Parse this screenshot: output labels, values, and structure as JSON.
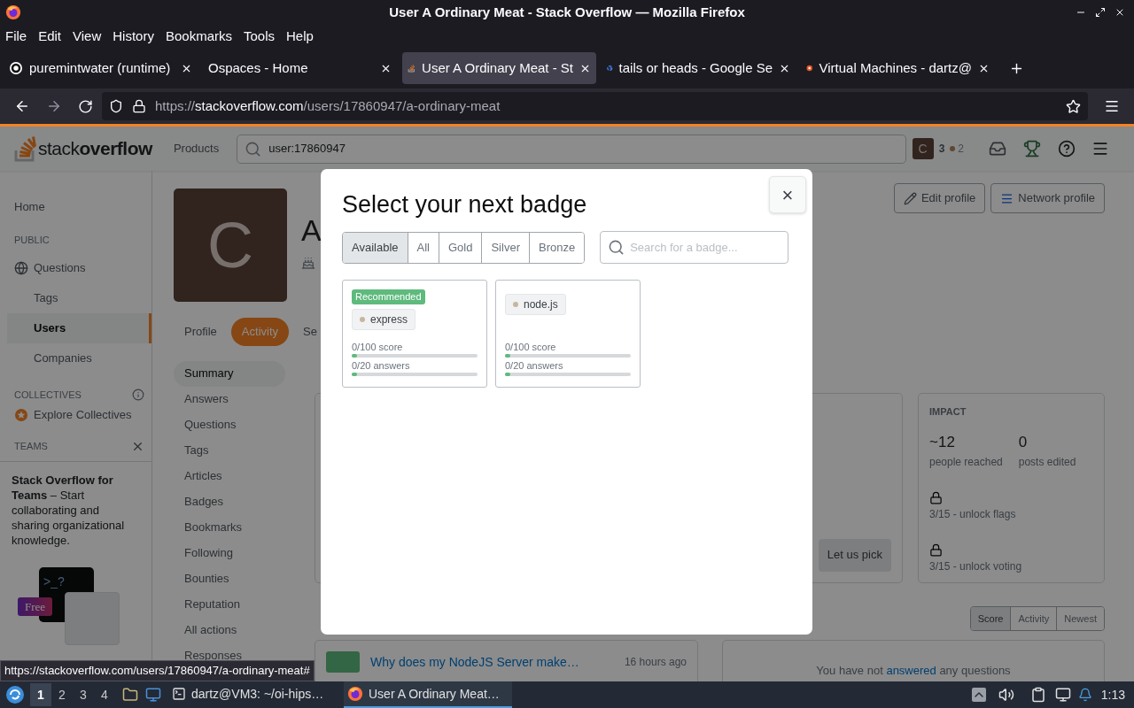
{
  "window": {
    "title": "User A Ordinary Meat - Stack Overflow — Mozilla Firefox"
  },
  "menu": [
    "File",
    "Edit",
    "View",
    "History",
    "Bookmarks",
    "Tools",
    "Help"
  ],
  "tabs": [
    {
      "label": "puremintwater (runtime)",
      "kind": "ring",
      "selected": false
    },
    {
      "label": "Ospaces - Home",
      "kind": "none",
      "selected": false
    },
    {
      "label": "User A Ordinary Meat - St",
      "kind": "stack",
      "selected": true
    },
    {
      "label": "tails or heads - Google Se",
      "kind": "google",
      "selected": false
    },
    {
      "label": "Virtual Machines - dartz@",
      "kind": "dot",
      "selected": false
    }
  ],
  "address": {
    "scheme": "https://",
    "domain": "stackoverflow.com",
    "path": "/users/17860947/a-ordinary-meat"
  },
  "header": {
    "logo": "stack**overflow**",
    "products": "Products",
    "search": "user:17860947",
    "avatar": "C",
    "reputation": "3",
    "bronze": "2"
  },
  "nav": {
    "home": "Home",
    "public": {
      "heading": "PUBLIC",
      "items": [
        {
          "label": "Questions",
          "kind": "main",
          "selected": false
        },
        {
          "label": "Tags",
          "kind": "sub",
          "selected": false
        },
        {
          "label": "Users",
          "kind": "sub",
          "selected": true
        },
        {
          "label": "Companies",
          "kind": "sub",
          "selected": false
        }
      ]
    },
    "collectives": {
      "heading": "COLLECTIVES",
      "item": "Explore Collectives"
    },
    "teams": {
      "heading": "TEAMS",
      "text": "**Stack Overflow for Teams** – Start collaborating and sharing organizational knowledge.",
      "prompt": ">_?",
      "badge": "Free"
    }
  },
  "profile": {
    "avatar": "C",
    "name": "A",
    "edit": "Edit profile",
    "network": "Network profile",
    "tabs": [
      {
        "label": "Profile",
        "selected": false
      },
      {
        "label": "Activity",
        "selected": true
      },
      {
        "label": "Se",
        "selected": false
      }
    ]
  },
  "activity_nav": [
    {
      "label": "Summary",
      "selected": true
    },
    {
      "label": "Answers",
      "selected": false
    },
    {
      "label": "Questions",
      "selected": false
    },
    {
      "label": "Tags",
      "selected": false
    },
    {
      "label": "Articles",
      "selected": false
    },
    {
      "label": "Badges",
      "selected": false
    },
    {
      "label": "Bookmarks",
      "selected": false
    },
    {
      "label": "Following",
      "selected": false
    },
    {
      "label": "Bounties",
      "selected": false
    },
    {
      "label": "Reputation",
      "selected": false
    },
    {
      "label": "All actions",
      "selected": false
    },
    {
      "label": "Responses",
      "selected": false
    }
  ],
  "summary": {
    "pick": "Let us pick",
    "impact": {
      "heading": "IMPACT",
      "stats": [
        {
          "value": "~12",
          "label": "people reached"
        },
        {
          "value": "0",
          "label": "posts edited"
        }
      ],
      "unlocks": [
        "3/15 - unlock flags",
        "3/15 - unlock voting"
      ]
    }
  },
  "questions": {
    "sort": [
      {
        "label": "Score",
        "selected": true
      },
      {
        "label": "Activity",
        "selected": false
      },
      {
        "label": "Newest",
        "selected": false
      }
    ],
    "items": [
      {
        "title": "Why does my NodeJS Server make…",
        "time": "16 hours ago"
      }
    ]
  },
  "answers": {
    "before": "You have not ",
    "link": "answered",
    "after": " any questions"
  },
  "modal": {
    "title": "Select your next badge",
    "close": "×",
    "filters": [
      {
        "label": "Available",
        "selected": true
      },
      {
        "label": "All",
        "selected": false
      },
      {
        "label": "Gold",
        "selected": false
      },
      {
        "label": "Silver",
        "selected": false
      },
      {
        "label": "Bronze",
        "selected": false
      }
    ],
    "search_placeholder": "Search for a badge...",
    "badges": [
      {
        "recommended": "Recommended",
        "tag": "express",
        "progress": [
          {
            "label": "0/100 score",
            "level": 0.04
          },
          {
            "label": "0/20 answers",
            "level": 0.04
          }
        ]
      },
      {
        "tag": "node.js",
        "progress": [
          {
            "label": "0/100 score",
            "level": 0.04
          },
          {
            "label": "0/20 answers",
            "level": 0.04
          }
        ]
      }
    ]
  },
  "status_link": "https://stackoverflow.com/users/17860947/a-ordinary-meat#",
  "taskbar": {
    "workspaces": [
      {
        "label": "1",
        "selected": true
      },
      {
        "label": "2",
        "selected": false
      },
      {
        "label": "3",
        "selected": false
      },
      {
        "label": "4",
        "selected": false
      }
    ],
    "tasks": [
      {
        "label": "dartz@VM3: ~/oi-hips…",
        "kind": "terminal",
        "selected": false
      },
      {
        "label": "User A Ordinary Meat…",
        "kind": "browser",
        "selected": true
      }
    ],
    "clock": "1:13"
  }
}
